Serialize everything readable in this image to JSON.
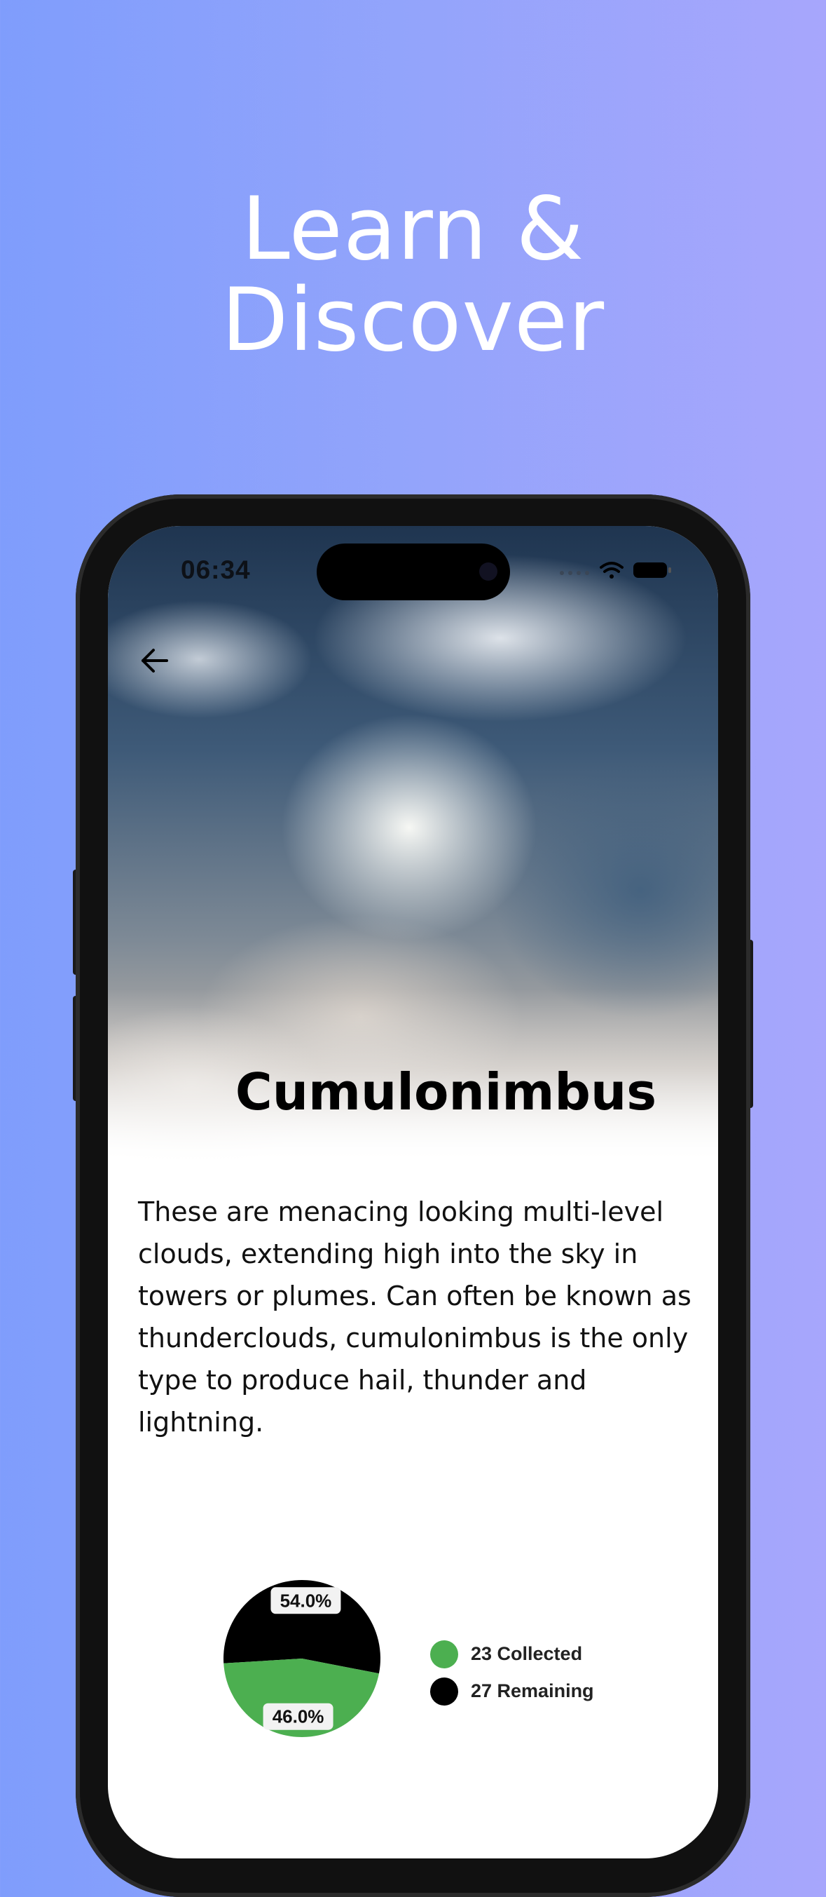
{
  "promo": {
    "headline_line1": "Learn &",
    "headline_line2": "Discover"
  },
  "status_bar": {
    "time": "06:34"
  },
  "detail": {
    "title": "Cumulonimbus",
    "description": "These are menacing looking multi-level clouds, extending high into the sky in towers or plumes. Can often be known as thunderclouds, cumulonimbus is the only type to produce hail, thunder and lightning.",
    "back_icon": "arrow-left-icon"
  },
  "colors": {
    "collected": "#4caf50",
    "remaining": "#000000"
  },
  "chart_data": {
    "type": "pie",
    "slices": [
      {
        "name": "Remaining",
        "value": 54.0,
        "label": "54.0%",
        "color": "#000000"
      },
      {
        "name": "Collected",
        "value": 46.0,
        "label": "46.0%",
        "color": "#4caf50"
      }
    ],
    "legend": [
      {
        "label": "23 Collected",
        "color": "#4caf50"
      },
      {
        "label": "27 Remaining",
        "color": "#000000"
      }
    ],
    "legend_position": "right"
  }
}
